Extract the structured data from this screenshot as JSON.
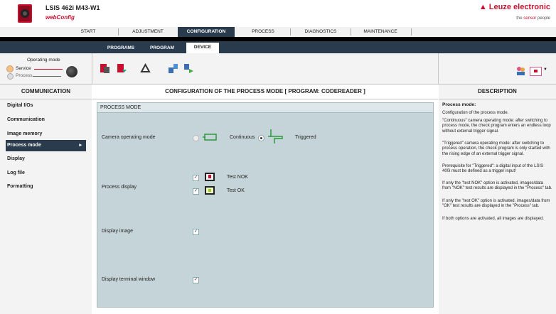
{
  "header": {
    "product_title": "LSIS 462i M43-W1",
    "product_subtitle": "webConfig",
    "brand": "Leuze electronic",
    "brand_tagline_pre": "the ",
    "brand_tagline_accent": "sensor",
    "brand_tagline_post": " people",
    "accent_color": "#c8102e"
  },
  "main_tabs": [
    {
      "label": "START"
    },
    {
      "label": "ADJUSTMENT"
    },
    {
      "label": "CONFIGURATION",
      "active": true
    },
    {
      "label": "PROCESS"
    },
    {
      "label": "DIAGNOSTICS"
    },
    {
      "label": "MAINTENANCE"
    }
  ],
  "sub_tabs": [
    {
      "label": "PROGRAMS"
    },
    {
      "label": "PROGRAM"
    },
    {
      "label": "DEVICE",
      "active": true
    }
  ],
  "operating_mode": {
    "title": "Operating mode",
    "service": "Service",
    "process": "Process",
    "selected": "Service"
  },
  "toolbar": {
    "icons": [
      "device-red-icon",
      "device-upload-icon",
      "recycle-icon",
      "transfer-in-icon",
      "transfer-out-icon"
    ],
    "right_icons": [
      "users-icon",
      "language-flag-icon"
    ]
  },
  "sidebar": {
    "heading": "COMMUNICATION",
    "items": [
      {
        "label": "Digital I/Os"
      },
      {
        "label": "Communication"
      },
      {
        "label": "Image memory"
      },
      {
        "label": "Process mode",
        "active": true
      },
      {
        "label": "Display"
      },
      {
        "label": "Log file"
      },
      {
        "label": "Formatting"
      }
    ]
  },
  "center": {
    "heading": "CONFIGURATION OF THE PROCESS MODE   [ PROGRAM: CODEREADER ]",
    "panel_title": "PROCESS MODE",
    "camera_mode": {
      "label": "Camera operating mode",
      "option_continuous": "Continuous",
      "option_triggered": "Triggered",
      "selected": "Triggered"
    },
    "process_display": {
      "label": "Process display",
      "test_nok": "Test NOK",
      "test_ok": "Test OK",
      "test_nok_checked": true,
      "test_ok_checked": true
    },
    "display_image": {
      "label": "Display image",
      "checked": true
    },
    "terminal_window": {
      "label": "Display terminal window",
      "checked": true
    }
  },
  "description": {
    "heading": "DESCRIPTION",
    "title": "Process mode:",
    "lines": [
      "Configuration of the process mode.",
      "\"Continuous\" camera operating mode: after switching to process mode, the check program enters an endless loop without external trigger signal.",
      "\"Triggered\" camera operating mode: after switching to process operation, the check program is only started with the rising edge of an external trigger signal.",
      "Prerequisite for \"Triggered\": a digital input of the LSIS 400i must be defined as a trigger input!",
      "If only the \"test NOK\" option is activated, images/data from \"NOK\" test results are displayed in the \"Process\" tab.",
      "If only the \"test OK\" option is activated, images/data from \"OK\" test results are displayed in the \"Process\" tab.",
      "If both options are activated, all images are displayed."
    ]
  }
}
